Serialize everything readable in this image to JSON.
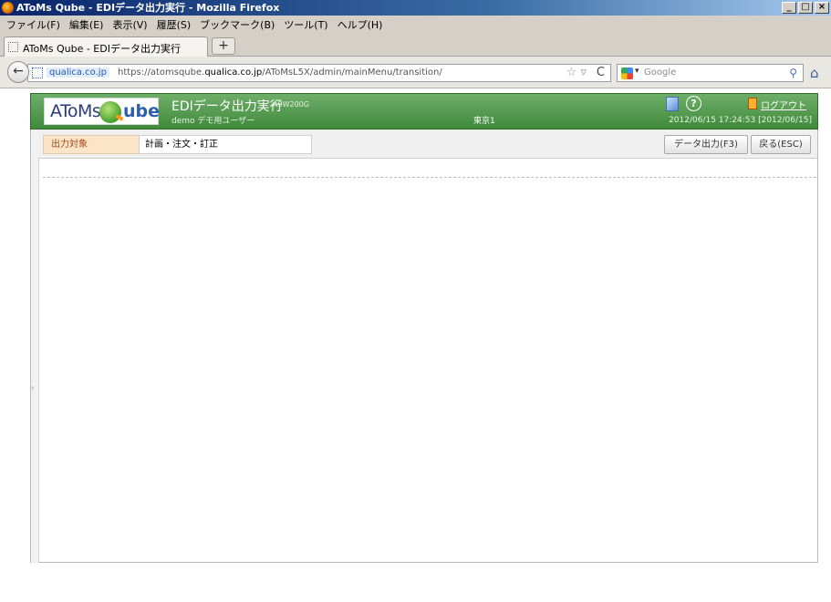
{
  "window": {
    "title": "AToMs Qube - EDIデータ出力実行 - Mozilla Firefox",
    "min": "_",
    "max": "□",
    "close": "×"
  },
  "menu": [
    "ファイル(F)",
    "編集(E)",
    "表示(V)",
    "履歴(S)",
    "ブックマーク(B)",
    "ツール(T)",
    "ヘルプ(H)"
  ],
  "tab": {
    "label": "AToMs Qube - EDIデータ出力実行",
    "new_tab": "+"
  },
  "nav": {
    "back": "←",
    "site": "qualica.co.jp",
    "url_prefix": "https://atomsqube.",
    "url_domain": "qualica.co.jp",
    "url_path": "/AToMsL5X/admin/mainMenu/transition/",
    "star": "☆ ▿",
    "reload": "C",
    "search_caret": "▾",
    "search_placeholder": "Google",
    "search_icon": "⚲",
    "home_icon": "⌂"
  },
  "app": {
    "logo_left": "AToMs",
    "logo_right": "ube",
    "title": "EDIデータ出力実行",
    "code": "A0W200G",
    "user": "demo デモ用ユーザー",
    "location": "東京1",
    "help": "?",
    "logout": "ログアウト",
    "datetime": "2012/06/15 17:24:53 [2012/06/15]"
  },
  "toolbar": {
    "output_label": "出力対象",
    "output_value": "計画・注文・訂正",
    "export_button": "データ出力(F3)",
    "back_button": "戻る(ESC)"
  },
  "side_arrow": "›"
}
